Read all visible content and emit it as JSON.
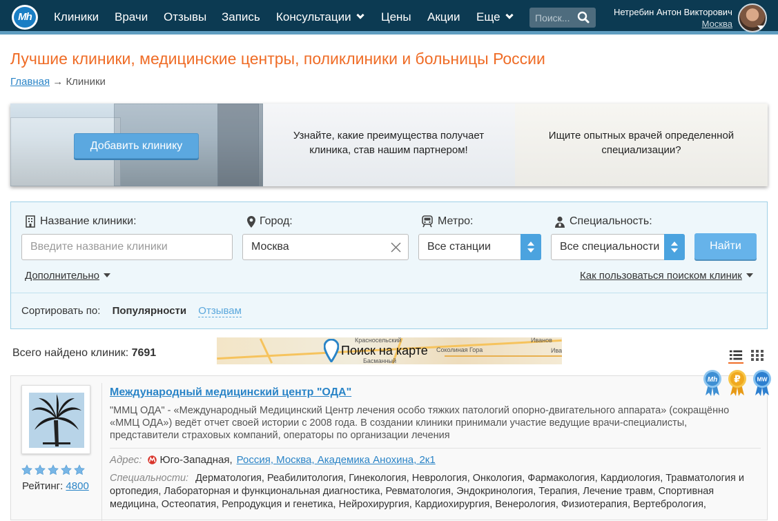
{
  "nav": {
    "logo": "Mh",
    "links": [
      "Клиники",
      "Врачи",
      "Отзывы",
      "Запись",
      "Консультации",
      "Цены",
      "Акции",
      "Еще"
    ],
    "search_placeholder": "Поиск...",
    "user_name": "Нетребин Антон Викторович",
    "user_city": "Москва"
  },
  "page": {
    "title": "Лучшие клиники, медицинские центры, поликлиники и больницы России",
    "breadcrumb_home": "Главная",
    "breadcrumb_sep": "→",
    "breadcrumb_current": "Клиники"
  },
  "banner": {
    "add_clinic": "Добавить клинику",
    "partner_text": "Узнайте, какие преимущества получает клиника, став нашим партнером!",
    "doctors_text": "Ищите опытных врачей определенной специализации?"
  },
  "filter": {
    "name_label": "Название клиники:",
    "name_placeholder": "Введите название клиники",
    "city_label": "Город:",
    "city_value": "Москва",
    "metro_label": "Метро:",
    "metro_value": "Все станции",
    "spec_label": "Специальность:",
    "spec_value": "Все специальности",
    "find_button": "Найти",
    "more_link": "Дополнительно",
    "howto_link": "Как пользоваться поиском клиник",
    "sort_label": "Сортировать по:",
    "sort_active": "Популярности",
    "sort_other": "Отзывам"
  },
  "results": {
    "total_label": "Всего найдено клиник:",
    "total_count": "7691",
    "map_label": "Поиск на карте",
    "map_streets": [
      "Иванов",
      "Ива",
      "Соколиная Гора",
      "Басманный",
      "Красносельский"
    ]
  },
  "badges": [
    "Mh",
    "₽",
    "MW"
  ],
  "clinic": {
    "title": "Международный медицинский центр \"ОДА\"",
    "description": "\"ММЦ ОДА\" - «Международный Медицинский Центр лечения особо тяжких патологий опорно-двигательного аппарата» (сокращённо «ММЦ ОДА») ведёт отчет своей истории с 2008 года. В создании клиники принимали участие ведущие врачи-специалисты, представители страховых компаний, операторы по организации лечения",
    "address_label": "Адрес:",
    "metro": "Юго-Западная,",
    "address": "Россия, Москва, Академика Анохина, 2к1",
    "spec_label": "Специальности:",
    "specialties": "Дерматология, Реабилитология, Гинекология, Неврология, Онкология, Фармакология, Кардиология, Травматология и ортопедия, Лабораторная и функциональная диагностика, Ревматология, Эндокринология, Терапия, Лечение травм, Спортивная медицина, Остеопатия, Репродукция и генетика, Нейрохирургия, Кардиохирургия, Венерология, Физиотерапия, Вертебрология,",
    "stars": 5,
    "rating_label": "Рейтинг:",
    "rating_value": "4800"
  },
  "colors": {
    "nav_bg": "#0c3a52",
    "accent_orange": "#ef6c26",
    "link_blue": "#2a84c7",
    "button_blue": "#5ba8e0"
  }
}
